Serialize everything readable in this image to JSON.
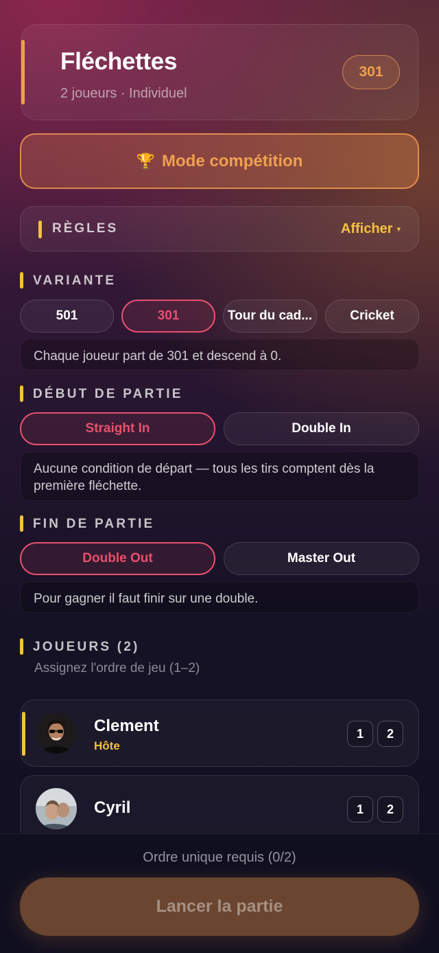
{
  "header": {
    "title": "Fléchettes",
    "subtitle": "2 joueurs · Individuel",
    "badge": "301"
  },
  "competition_button": {
    "icon": "trophy-icon",
    "label": "Mode compétition"
  },
  "rules": {
    "label": "RÈGLES",
    "toggle_label": "Afficher",
    "toggle_caret": "▾"
  },
  "variant": {
    "title": "VARIANTE",
    "options": [
      "501",
      "301",
      "Tour du cad...",
      "Cricket"
    ],
    "selected": "301",
    "description": "Chaque joueur part de 301 et descend à 0."
  },
  "start": {
    "title": "DÉBUT DE PARTIE",
    "options": [
      "Straight In",
      "Double In"
    ],
    "selected": "Straight In",
    "description": "Aucune condition de départ — tous les tirs comptent dès la première fléchette."
  },
  "end": {
    "title": "FIN DE PARTIE",
    "options": [
      "Double Out",
      "Master Out"
    ],
    "selected": "Double Out",
    "description": "Pour gagner il faut finir sur une double."
  },
  "players": {
    "title": "JOUEURS (2)",
    "subtitle": "Assignez l'ordre de jeu (1–2)",
    "list": [
      {
        "name": "Clement",
        "role": "Hôte",
        "order_options": [
          "1",
          "2"
        ]
      },
      {
        "name": "Cyril",
        "role": "",
        "order_options": [
          "1",
          "2"
        ]
      }
    ]
  },
  "footer": {
    "status": "Ordre unique requis (0/2)",
    "launch_label": "Lancer la partie"
  },
  "colors": {
    "accent_orange": "#f0a050",
    "accent_yellow": "#f3c23a",
    "selected_pink": "#e8506e"
  }
}
